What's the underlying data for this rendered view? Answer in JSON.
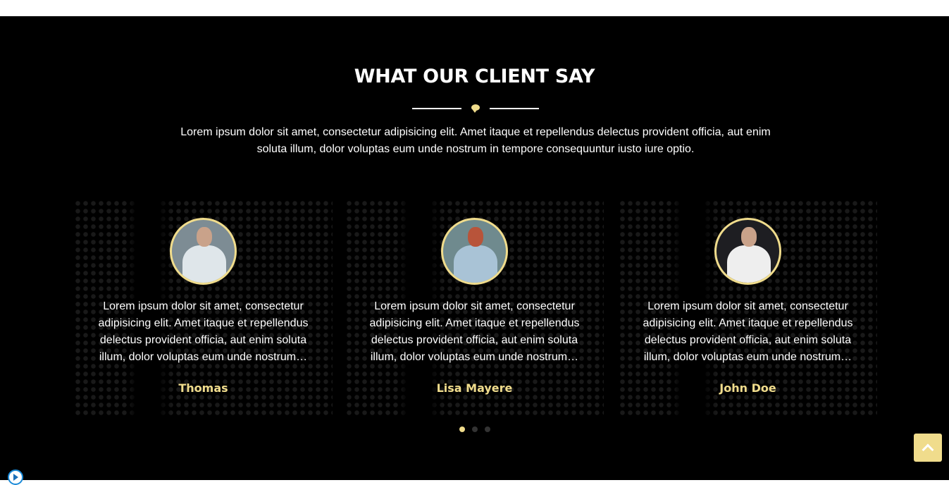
{
  "section": {
    "title": "WHAT OUR CLIENT SAY",
    "divider_icon": "comment-icon",
    "intro": "Lorem ipsum dolor sit amet, consectetur adipisicing elit. Amet itaque et repellendus delectus provident officia, aut enim soluta illum, dolor voluptas eum unde nostrum in tempore consequuntur iusto iure optio."
  },
  "testimonials": [
    {
      "quote": "Lorem ipsum dolor sit amet, consectetur adipisicing elit. Amet itaque et repellendus delectus provident officia, aut enim soluta illum, dolor voluptas eum unde nostrum…",
      "name": "Thomas"
    },
    {
      "quote": "Lorem ipsum dolor sit amet, consectetur adipisicing elit. Amet itaque et repellendus delectus provident officia, aut enim soluta illum, dolor voluptas eum unde nostrum…",
      "name": "Lisa Mayere"
    },
    {
      "quote": "Lorem ipsum dolor sit amet, consectetur adipisicing elit. Amet itaque et repellendus delectus provident officia, aut enim soluta illum, dolor voluptas eum unde nostrum…",
      "name": "John Doe"
    }
  ],
  "pager": {
    "pages": 3,
    "active": 1
  },
  "colors": {
    "accent": "#f0dc8c",
    "background": "#000000"
  },
  "scroll_top_icon": "chevron-up-icon"
}
